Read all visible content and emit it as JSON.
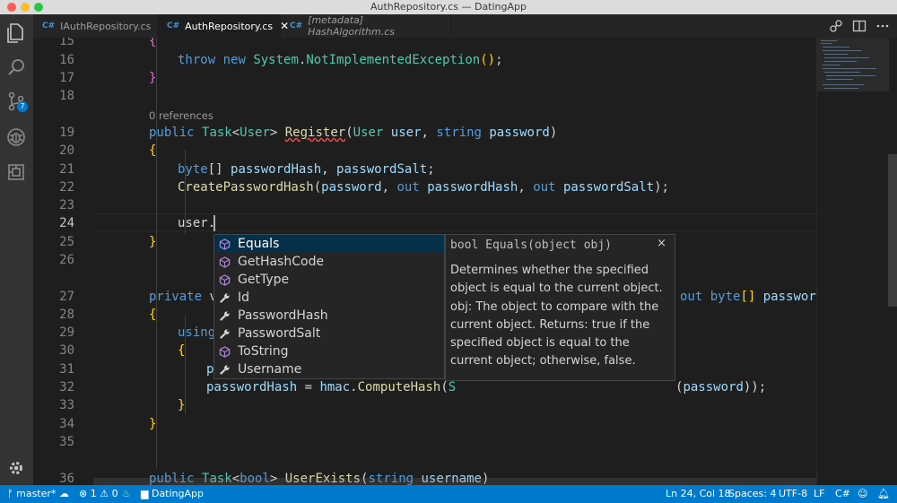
{
  "window": {
    "title": "AuthRepository.cs — DatingApp"
  },
  "activity_bar": {
    "scm_badge": "7"
  },
  "tabs": [
    {
      "icon": "C#",
      "label": "IAuthRepository.cs",
      "italic": false,
      "active": false
    },
    {
      "icon": "C#",
      "label": "AuthRepository.cs",
      "italic": false,
      "active": true
    },
    {
      "icon": "C#",
      "label": "[metadata] HashAlgorithm.cs",
      "italic": true,
      "active": false
    }
  ],
  "editor": {
    "code_lens": "0 references",
    "lines": [
      {
        "n": "15",
        "text": "{"
      },
      {
        "n": "16",
        "text": "throw new System.NotImplementedException();"
      },
      {
        "n": "17",
        "text": "}"
      },
      {
        "n": "18",
        "text": ""
      },
      {
        "n": "19",
        "text": "public Task<User> Register(User user, string password)"
      },
      {
        "n": "20",
        "text": "{"
      },
      {
        "n": "21",
        "text": "byte[] passwordHash, passwordSalt;"
      },
      {
        "n": "22",
        "text": "CreatePasswordHash(password, out passwordHash, out passwordSalt);"
      },
      {
        "n": "23",
        "text": ""
      },
      {
        "n": "24",
        "text": "user."
      },
      {
        "n": "25",
        "text": "}"
      },
      {
        "n": "26",
        "text": ""
      },
      {
        "n": "27",
        "text": "private v"
      },
      {
        "n": "28",
        "text": "{"
      },
      {
        "n": "29",
        "text": "using"
      },
      {
        "n": "30",
        "text": "{"
      },
      {
        "n": "31",
        "text": "p"
      },
      {
        "n": "32",
        "text": "passwordHash = hmac.ComputeHash(S"
      },
      {
        "n": "33",
        "text": "}"
      },
      {
        "n": "34",
        "text": "}"
      },
      {
        "n": "35",
        "text": ""
      },
      {
        "n": "36",
        "text": "public Task<bool> UserExists(string username)"
      }
    ],
    "line27_right": "out byte[] passwordS"
  },
  "suggest": {
    "items": [
      {
        "label": "Equals",
        "kind": "method",
        "selected": true
      },
      {
        "label": "GetHashCode",
        "kind": "method",
        "selected": false
      },
      {
        "label": "GetType",
        "kind": "method",
        "selected": false
      },
      {
        "label": "Id",
        "kind": "property",
        "selected": false
      },
      {
        "label": "PasswordHash",
        "kind": "property",
        "selected": false
      },
      {
        "label": "PasswordSalt",
        "kind": "property",
        "selected": false
      },
      {
        "label": "ToString",
        "kind": "method",
        "selected": false
      },
      {
        "label": "Username",
        "kind": "property",
        "selected": false
      }
    ]
  },
  "details": {
    "signature": "bool Equals(object obj)",
    "close": "×",
    "doc": "Determines whether the specified object is equal to the current object. obj: The object to compare with the current object. Returns: true if the specified object is equal to the current object; otherwise, false."
  },
  "statusbar": {
    "branch": "master*",
    "errors": "1",
    "warnings": "0",
    "folder": "DatingApp",
    "position": "Ln 24, Col 18",
    "spaces": "Spaces: 4",
    "encoding": "UTF-8",
    "eol": "LF",
    "language": "C#"
  },
  "colors": {
    "accent": "#007acc",
    "selection": "#062f4a",
    "method_icon": "#b180d7"
  }
}
